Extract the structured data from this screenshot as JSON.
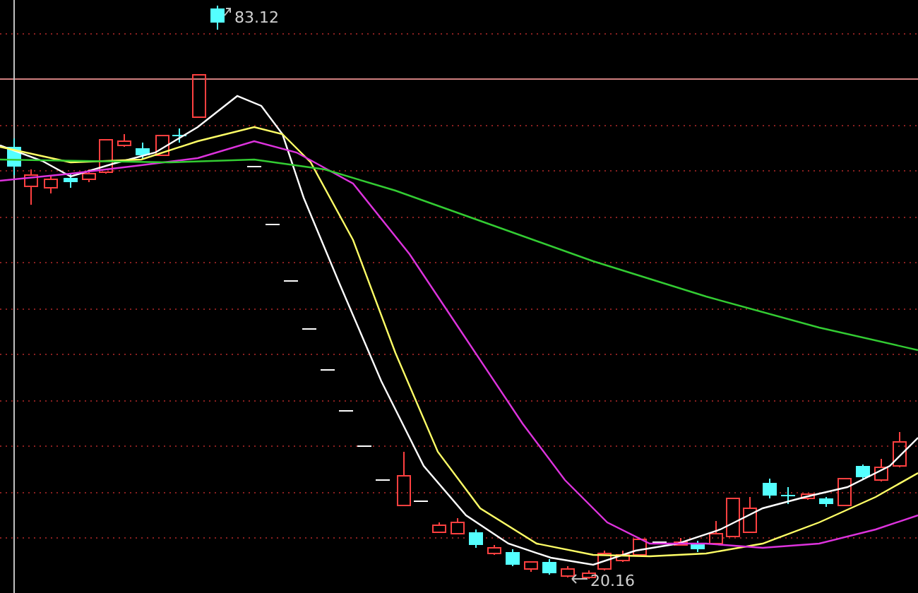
{
  "chart": {
    "high_label": "83.12",
    "low_label": "20.16"
  }
}
